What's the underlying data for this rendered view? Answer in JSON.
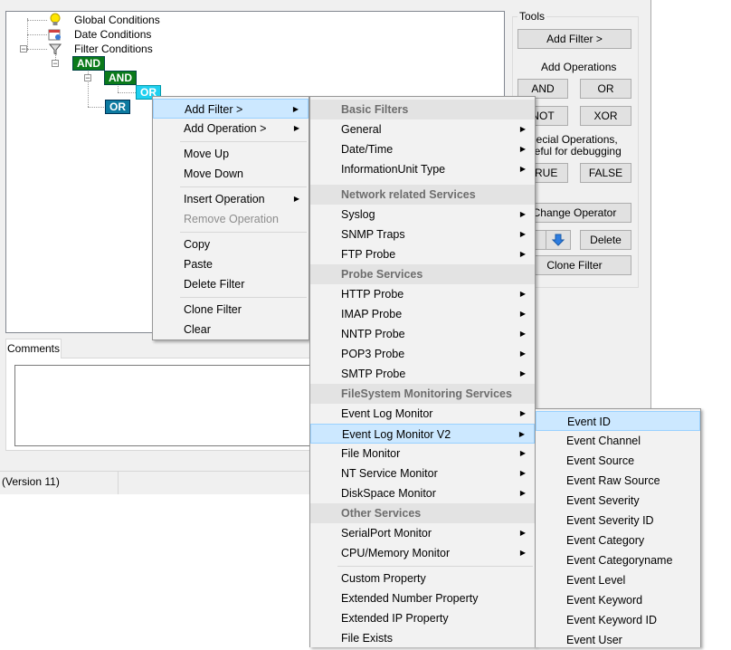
{
  "tree": {
    "items": [
      {
        "label": "Global Conditions",
        "icon": "lightbulb-icon"
      },
      {
        "label": "Date Conditions",
        "icon": "calendar-icon"
      },
      {
        "label": "Filter Conditions",
        "icon": "funnel-icon"
      }
    ],
    "and1": "AND",
    "and2": "AND",
    "or_selected": "OR",
    "or2": "OR"
  },
  "tools": {
    "title": "Tools",
    "add_filter": "Add Filter >",
    "add_operations_label": "Add Operations",
    "and": "AND",
    "or": "OR",
    "not": "NOT",
    "xor": "XOR",
    "special_label_1": "Special Operations,",
    "special_label_2": "useful for debugging",
    "true": "TRUE",
    "false": "FALSE",
    "change_operator": "Change Operator",
    "delete": "Delete",
    "clone_filter": "Clone Filter"
  },
  "comments": {
    "tab": "Comments"
  },
  "status": {
    "version": "(Version 11)"
  },
  "context_menu": {
    "add_filter": "Add Filter >",
    "add_operation": "Add Operation >",
    "move_up": "Move Up",
    "move_down": "Move Down",
    "insert_operation": "Insert Operation",
    "remove_operation": "Remove Operation",
    "copy": "Copy",
    "paste": "Paste",
    "delete_filter": "Delete Filter",
    "clone_filter": "Clone Filter",
    "clear": "Clear"
  },
  "filter_menu": {
    "basic_filters": "Basic Filters",
    "general": "General",
    "date_time": "Date/Time",
    "information_unit_type": "InformationUnit Type",
    "network_services": "Network related Services",
    "syslog": "Syslog",
    "snmp_traps": "SNMP Traps",
    "ftp_probe": "FTP Probe",
    "probe_services": "Probe Services",
    "http_probe": "HTTP Probe",
    "imap_probe": "IMAP Probe",
    "nntp_probe": "NNTP Probe",
    "pop3_probe": "POP3 Probe",
    "smtp_probe": "SMTP Probe",
    "filesystem_services": "FileSystem Monitoring Services",
    "event_log_monitor": "Event Log Monitor",
    "event_log_monitor_v2": "Event Log Monitor V2",
    "file_monitor": "File Monitor",
    "nt_service_monitor": "NT Service Monitor",
    "diskspace_monitor": "DiskSpace Monitor",
    "other_services": "Other Services",
    "serialport_monitor": "SerialPort Monitor",
    "cpu_memory_monitor": "CPU/Memory Monitor",
    "custom_property": "Custom Property",
    "extended_number_property": "Extended Number Property",
    "extended_ip_property": "Extended IP Property",
    "file_exists": "File Exists"
  },
  "event_menu": {
    "items": [
      "Event ID",
      "Event Channel",
      "Event Source",
      "Event Raw Source",
      "Event Severity",
      "Event Severity ID",
      "Event Category",
      "Event Categoryname",
      "Event Level",
      "Event Keyword",
      "Event Keyword ID",
      "Event User"
    ]
  }
}
